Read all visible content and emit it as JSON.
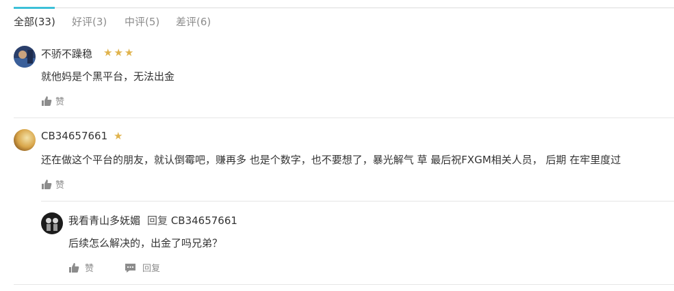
{
  "tabs": [
    {
      "label": "全部(33)",
      "active": true
    },
    {
      "label": "好评(3)",
      "active": false
    },
    {
      "label": "中评(5)",
      "active": false
    },
    {
      "label": "差评(6)",
      "active": false
    }
  ],
  "comments": [
    {
      "username": "不骄不躁稳",
      "stars": "★★★",
      "rating": 3,
      "content": "就他妈是个黑平台，无法出金",
      "like_label": "赞"
    },
    {
      "username": "CB34657661",
      "stars": "★",
      "rating": 1,
      "content": "还在做这个平台的朋友，就认倒霉吧，赚再多 也是个数字，也不要想了，暴光解气 草 最后祝FXGM相关人员， 后期 在牢里度过",
      "like_label": "赞",
      "reply": {
        "username": "我看青山多妩媚",
        "reply_word": "回复",
        "reply_to": "CB34657661",
        "content": "后续怎么解决的，出金了吗兄弟？",
        "like_label": "赞",
        "reply_label": "回复"
      }
    }
  ],
  "colors": {
    "accent": "#3cc0d8",
    "star": "#e0b34c",
    "muted": "#8c8c8c"
  }
}
